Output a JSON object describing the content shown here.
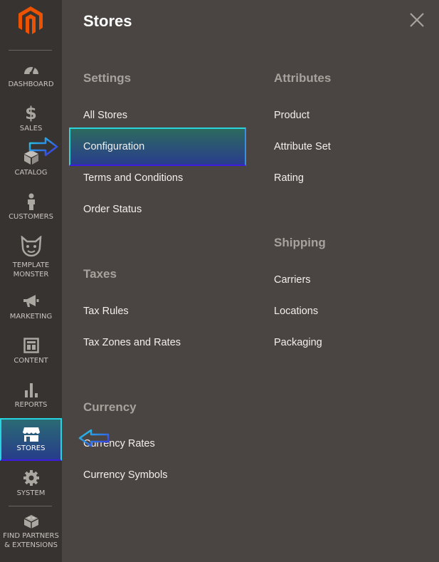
{
  "sidebar": {
    "items": [
      {
        "label": "DASHBOARD",
        "icon": "speedometer-icon"
      },
      {
        "label": "SALES",
        "icon": "dollar-icon"
      },
      {
        "label": "CATALOG",
        "icon": "box-icon"
      },
      {
        "label": "CUSTOMERS",
        "icon": "person-icon"
      },
      {
        "label": "TEMPLATE\nMONSTER",
        "icon": "monster-icon"
      },
      {
        "label": "MARKETING",
        "icon": "megaphone-icon"
      },
      {
        "label": "CONTENT",
        "icon": "layout-icon"
      },
      {
        "label": "REPORTS",
        "icon": "bar-chart-icon"
      },
      {
        "label": "STORES",
        "icon": "storefront-icon",
        "active": true
      },
      {
        "label": "SYSTEM",
        "icon": "gear-icon"
      },
      {
        "label": "FIND PARTNERS\n& EXTENSIONS",
        "icon": "lego-brick-icon"
      }
    ]
  },
  "panel": {
    "title": "Stores",
    "columns": [
      {
        "sections": [
          {
            "title": "Settings",
            "links": [
              "All Stores",
              "Configuration",
              "Terms and Conditions",
              "Order Status"
            ]
          },
          {
            "title": "Taxes",
            "links": [
              "Tax Rules",
              "Tax Zones and Rates"
            ]
          },
          {
            "title": "Currency",
            "links": [
              "Currency Rates",
              "Currency Symbols"
            ]
          }
        ]
      },
      {
        "sections": [
          {
            "title": "Attributes",
            "links": [
              "Product",
              "Attribute Set",
              "Rating"
            ]
          },
          {
            "title": "Shipping",
            "links": [
              "Carriers",
              "Locations",
              "Packaging"
            ]
          }
        ]
      }
    ],
    "highlighted_link": "Configuration"
  },
  "colors": {
    "sidebar_bg": "#373330",
    "panel_bg": "#4a4542",
    "accent_orange": "#eb5202",
    "highlight_cyan": "#25d4e0",
    "highlight_blue": "#3d1ee0"
  }
}
